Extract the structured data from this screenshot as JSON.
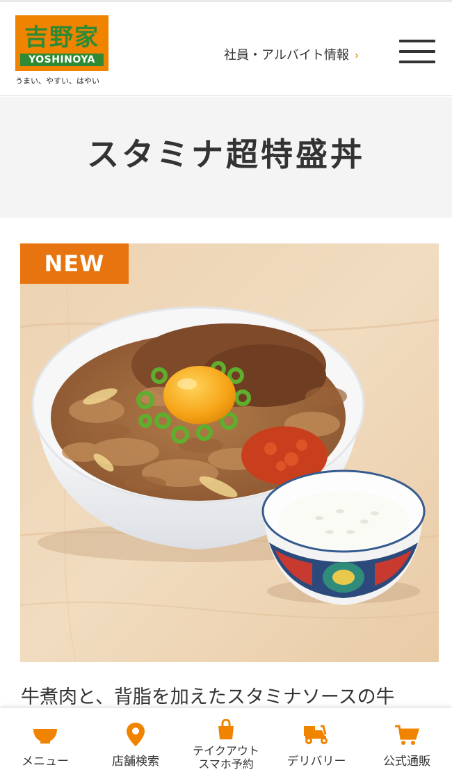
{
  "header": {
    "logo_kanji": "吉野家",
    "logo_brand": "YOSHINOYA",
    "tagline": "うまい、やすい、はやい",
    "recruit_link": "社員・アルバイト情報",
    "recruit_chevron": "›",
    "menu_icon": "hamburger-icon"
  },
  "page": {
    "title": "スタミナ超特盛丼"
  },
  "product": {
    "badge": "NEW",
    "description": "牛煮肉と、背脂を加えたスタミナソースの牛"
  },
  "bottom_nav": {
    "items": [
      {
        "label": "メニュー",
        "icon": "bowl-icon"
      },
      {
        "label": "店舗検索",
        "icon": "map-pin-icon"
      },
      {
        "label": "テイクアウト\nスマホ予約",
        "line1": "テイクアウト",
        "line2": "スマホ予約",
        "icon": "takeout-bag-icon"
      },
      {
        "label": "デリバリー",
        "icon": "delivery-scooter-icon"
      },
      {
        "label": "公式通販",
        "icon": "shopping-cart-icon"
      }
    ]
  },
  "colors": {
    "accent_orange": "#f08300",
    "badge_orange": "#e8740f",
    "brand_green": "#2f8a35",
    "text": "#333333",
    "title_band": "#f4f4f4"
  }
}
